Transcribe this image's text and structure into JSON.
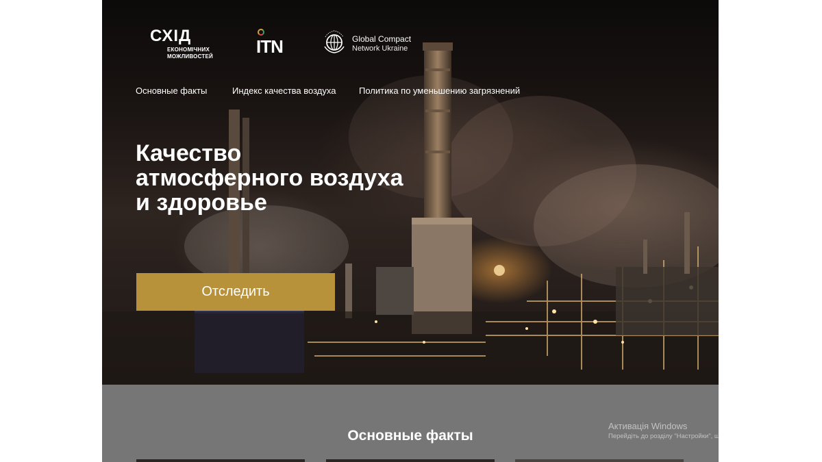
{
  "logos": {
    "sxid": {
      "mark": "СХІД",
      "subtitle_line1": "ЕКОНОМІЧНИХ",
      "subtitle_line2": "МОЖЛИВОСТЕЙ"
    },
    "itn": {
      "mark": "ITN"
    },
    "global_compact": {
      "title": "Global Compact",
      "subtitle": "Network Ukraine",
      "emblem_text": "UN GLOBAL COMPACT"
    }
  },
  "nav": {
    "items": [
      {
        "label": "Основные факты"
      },
      {
        "label": "Индекс качества воздуха"
      },
      {
        "label": "Политика по уменьшению загрязнений"
      }
    ]
  },
  "hero": {
    "title_line1": "Качество",
    "title_line2": "атмосферного воздуха",
    "title_line3": "и здоровье",
    "cta_label": "Отследить"
  },
  "facts": {
    "title": "Основные факты"
  },
  "windows_watermark": {
    "title": "Активація Windows",
    "subtitle": "Перейдіть до розділу \"Настройки\", щоб активувати Windows."
  },
  "colors": {
    "accent_gold": "#b8913b",
    "section_gray": "#767676",
    "page_bg": "#ffffff"
  }
}
